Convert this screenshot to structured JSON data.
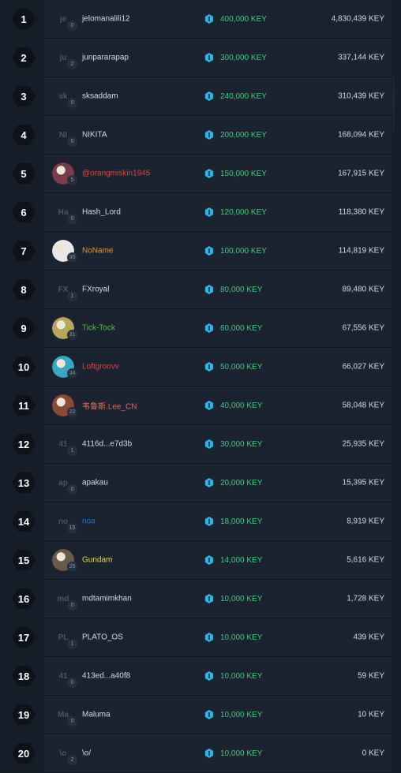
{
  "currency_icon": "key-hex-icon",
  "colors": {
    "prize_green": "#35d07a",
    "key_cyan": "#22b8e8",
    "name_default": "#d6dbe3"
  },
  "rows": [
    {
      "rank": "1",
      "initials": "je",
      "level": "0",
      "username": "jelomanalili12",
      "name_color": "#d6dbe3",
      "prize": "400,000 KEY",
      "total": "4,830,439 KEY",
      "avatar": "initials"
    },
    {
      "rank": "2",
      "initials": "ju",
      "level": "2",
      "username": "junpararapap",
      "name_color": "#d6dbe3",
      "prize": "300,000 KEY",
      "total": "337,144 KEY",
      "avatar": "initials"
    },
    {
      "rank": "3",
      "initials": "sk",
      "level": "0",
      "username": "sksaddam",
      "name_color": "#d6dbe3",
      "prize": "240,000 KEY",
      "total": "310,439 KEY",
      "avatar": "initials"
    },
    {
      "rank": "4",
      "initials": "NI",
      "level": "0",
      "username": "NIKITA",
      "name_color": "#d6dbe3",
      "prize": "200,000 KEY",
      "total": "168,094 KEY",
      "avatar": "initials"
    },
    {
      "rank": "5",
      "initials": "",
      "level": "5",
      "username": "@orangmiskin1945",
      "name_color": "#e0453a",
      "prize": "150,000 KEY",
      "total": "167,915 KEY",
      "avatar": "photo",
      "avatar_color": "#7a3b4a"
    },
    {
      "rank": "6",
      "initials": "Ha",
      "level": "0",
      "username": "Hash_Lord",
      "name_color": "#d6dbe3",
      "prize": "120,000 KEY",
      "total": "118,380 KEY",
      "avatar": "initials"
    },
    {
      "rank": "7",
      "initials": "",
      "level": "30",
      "username": "NoName",
      "name_color": "#e8952f",
      "prize": "100,000 KEY",
      "total": "114,819 KEY",
      "avatar": "photo",
      "avatar_color": "#e8e8e8"
    },
    {
      "rank": "8",
      "initials": "FX",
      "level": "1",
      "username": "FXroyal",
      "name_color": "#d6dbe3",
      "prize": "80,000 KEY",
      "total": "89,480 KEY",
      "avatar": "initials"
    },
    {
      "rank": "9",
      "initials": "",
      "level": "31",
      "username": "Tick-Tock",
      "name_color": "#5cbf4a",
      "prize": "60,000 KEY",
      "total": "67,556 KEY",
      "avatar": "photo",
      "avatar_color": "#b8a65a"
    },
    {
      "rank": "10",
      "initials": "",
      "level": "34",
      "username": "Loftgroovv",
      "name_color": "#e0453a",
      "prize": "50,000 KEY",
      "total": "66,027 KEY",
      "avatar": "photo",
      "avatar_color": "#3aa6c4"
    },
    {
      "rank": "11",
      "initials": "",
      "level": "22",
      "username": "韦鲁斯.Lee_CN",
      "name_color": "#e0705a",
      "prize": "40,000 KEY",
      "total": "58,048 KEY",
      "avatar": "photo",
      "avatar_color": "#8a4a3a"
    },
    {
      "rank": "12",
      "initials": "41",
      "level": "1",
      "username": "4116d...e7d3b",
      "name_color": "#d6dbe3",
      "prize": "30,000 KEY",
      "total": "25,935 KEY",
      "avatar": "initials"
    },
    {
      "rank": "13",
      "initials": "ap",
      "level": "0",
      "username": "apakau",
      "name_color": "#d6dbe3",
      "prize": "20,000 KEY",
      "total": "15,395 KEY",
      "avatar": "initials"
    },
    {
      "rank": "14",
      "initials": "no",
      "level": "15",
      "username": "noa",
      "name_color": "#2f6fcf",
      "prize": "18,000 KEY",
      "total": "8,919 KEY",
      "avatar": "initials"
    },
    {
      "rank": "15",
      "initials": "",
      "level": "25",
      "username": "Gundam",
      "name_color": "#e6d83a",
      "prize": "14,000 KEY",
      "total": "5,616 KEY",
      "avatar": "photo",
      "avatar_color": "#6a5a4a"
    },
    {
      "rank": "16",
      "initials": "md",
      "level": "0",
      "username": "mdtamimkhan",
      "name_color": "#d6dbe3",
      "prize": "10,000 KEY",
      "total": "1,728 KEY",
      "avatar": "initials"
    },
    {
      "rank": "17",
      "initials": "PL",
      "level": "1",
      "username": "PLATO_OS",
      "name_color": "#d6dbe3",
      "prize": "10,000 KEY",
      "total": "439 KEY",
      "avatar": "initials"
    },
    {
      "rank": "18",
      "initials": "41",
      "level": "0",
      "username": "413ed...a40f8",
      "name_color": "#d6dbe3",
      "prize": "10,000 KEY",
      "total": "59 KEY",
      "avatar": "initials"
    },
    {
      "rank": "19",
      "initials": "Ma",
      "level": "0",
      "username": "Maluma",
      "name_color": "#d6dbe3",
      "prize": "10,000 KEY",
      "total": "10 KEY",
      "avatar": "initials"
    },
    {
      "rank": "20",
      "initials": "\\o",
      "level": "2",
      "username": "\\o/",
      "name_color": "#d6dbe3",
      "prize": "10,000 KEY",
      "total": "0 KEY",
      "avatar": "initials"
    }
  ]
}
